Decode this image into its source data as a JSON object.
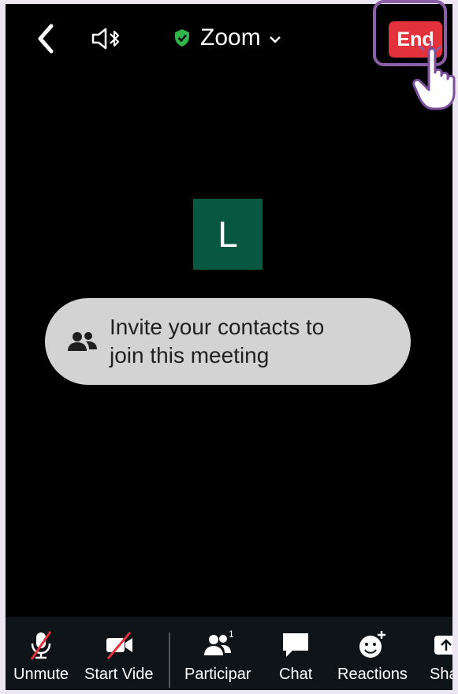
{
  "header": {
    "title": "Zoom",
    "end_label": "End",
    "colors": {
      "end": "#e3323b",
      "shield": "#2fb34a",
      "highlight": "#8b5ea8"
    },
    "icons": [
      "back-arrow-icon",
      "speaker-bluetooth-icon",
      "shield-check-icon",
      "chevron-down-icon"
    ]
  },
  "participant": {
    "initial": "L",
    "color": "#075741"
  },
  "invite": {
    "line1": "Invite your contacts to",
    "line2": "join this meeting"
  },
  "toolbar": {
    "items": [
      {
        "label": "Unmute",
        "icon": "mic-muted-icon"
      },
      {
        "label": "Start Vide",
        "icon": "video-off-icon"
      },
      {
        "label": "Participar",
        "icon": "participants-icon",
        "badge": "1"
      },
      {
        "label": "Chat",
        "icon": "chat-icon"
      },
      {
        "label": "Reactions",
        "icon": "reactions-icon"
      },
      {
        "label": "Sha",
        "icon": "share-icon"
      }
    ]
  }
}
